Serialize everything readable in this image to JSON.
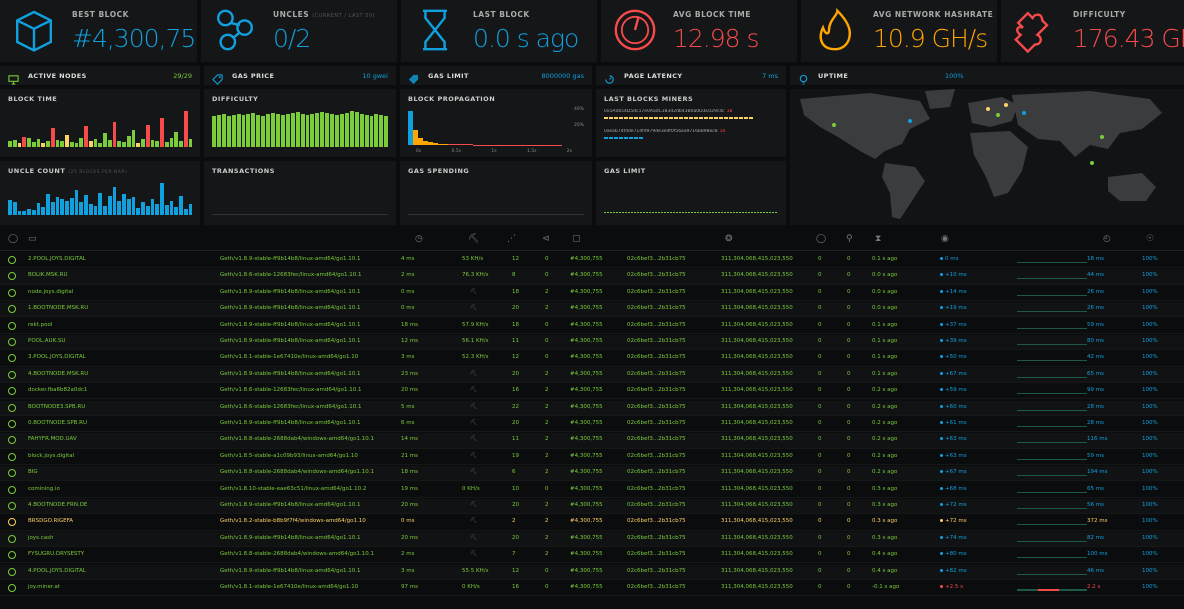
{
  "stats": [
    {
      "id": "best-block",
      "label": "BEST BLOCK",
      "sublabel": "",
      "value": "#4,300,755",
      "icon": "cube-icon",
      "color": "#10a0de"
    },
    {
      "id": "uncles",
      "label": "UNCLES",
      "sublabel": "(CURRENT / LAST 50)",
      "value": "0/2",
      "icon": "uncles-icon",
      "color": "#10a0de"
    },
    {
      "id": "last-block",
      "label": "LAST BLOCK",
      "sublabel": "",
      "value": "0.0 s ago",
      "icon": "hourglass-icon",
      "color": "#10a0de"
    },
    {
      "id": "avg-block-time",
      "label": "AVG BLOCK TIME",
      "sublabel": "",
      "value": "12.98 s",
      "icon": "gauge-icon",
      "color": "#f74b4b"
    },
    {
      "id": "avg-hashrate",
      "label": "AVG NETWORK HASHRATE",
      "sublabel": "",
      "value": "10.9 GH/s",
      "icon": "fire-icon",
      "color": "#ffa600"
    },
    {
      "id": "difficulty",
      "label": "DIFFICULTY",
      "sublabel": "",
      "value": "176.43 GH",
      "icon": "puzzle-icon",
      "color": "#f74b4b"
    }
  ],
  "info": [
    {
      "id": "active-nodes",
      "label": "ACTIVE NODES",
      "value": "29/29",
      "icon": "monitor-icon",
      "color": "#7bcc3a"
    },
    {
      "id": "gas-price",
      "label": "GAS PRICE",
      "value": "10 gwei",
      "icon": "gas-tag-icon",
      "color": "#10a0de"
    },
    {
      "id": "gas-limit",
      "label": "GAS LIMIT",
      "value": "8000000 gas",
      "icon": "gas-limit-icon",
      "color": "#10a0de"
    },
    {
      "id": "page-latency",
      "label": "PAGE LATENCY",
      "value": "7 ms",
      "icon": "latency-icon",
      "color": "#10a0de"
    },
    {
      "id": "uptime",
      "label": "UPTIME",
      "value": "100%",
      "icon": "lightbulb-icon",
      "color": "#10a0de"
    }
  ],
  "panels": {
    "block_time": "BLOCK TIME",
    "difficulty": "DIFFICULTY",
    "block_propagation": "BLOCK PROPAGATION",
    "last_blocks_miners": "LAST BLOCKS MINERS",
    "uncle_count": "UNCLE COUNT",
    "uncle_count_sub": "(25 BLOCKS PER BAR)",
    "transactions": "TRANSACTIONS",
    "gas_spending": "GAS SPENDING",
    "gas_limit": "GAS LIMIT"
  },
  "propagation": {
    "y_ticks": [
      "40%",
      "20%"
    ],
    "x_ticks": [
      "0s",
      "0.5s",
      "1s",
      "1.5s",
      "2s"
    ]
  },
  "miners": [
    {
      "address": "0x5A0b54D5dc17e0AadC383d2db43B0a0D3E029c4c",
      "count": "18"
    },
    {
      "address": "0xea674fdde714fd979de3edf0f56aa9716b898ec8",
      "count": "10"
    }
  ],
  "charts": {
    "block_time": [
      10,
      12,
      8,
      18,
      16,
      9,
      14,
      7,
      10,
      34,
      12,
      11,
      22,
      9,
      8,
      17,
      38,
      11,
      14,
      8,
      26,
      12,
      45,
      10,
      9,
      19,
      31,
      8,
      15,
      40,
      12,
      11,
      52,
      9,
      16,
      28,
      10,
      65,
      14
    ],
    "block_time_red": [
      3,
      9,
      16,
      22,
      29,
      32,
      37
    ],
    "difficulty": [
      62,
      64,
      66,
      63,
      65,
      67,
      64,
      66,
      68,
      65,
      63,
      66,
      69,
      67,
      64,
      66,
      68,
      70,
      66,
      65,
      67,
      69,
      71,
      68,
      66,
      64,
      67,
      69,
      72,
      70,
      67,
      65,
      63,
      66,
      64,
      62
    ],
    "propagation": [
      92,
      40,
      18,
      10,
      7,
      5,
      4,
      3,
      3,
      2,
      2,
      2,
      2,
      1,
      1,
      1,
      1,
      1,
      1,
      1,
      1,
      1,
      1,
      1,
      1,
      1,
      1,
      1,
      1,
      1,
      1
    ],
    "uncle_count": [
      42,
      38,
      12,
      10,
      18,
      14,
      34,
      22,
      60,
      36,
      52,
      44,
      40,
      48,
      70,
      38,
      56,
      30,
      26,
      62,
      24,
      54,
      80,
      40,
      58,
      46,
      50,
      20,
      36,
      24,
      44,
      32,
      90,
      28,
      40,
      22,
      54,
      18,
      30
    ]
  },
  "map_dots": [
    {
      "country": "US-West",
      "color": "#7bcc3a"
    },
    {
      "country": "US-East",
      "color": "#10a0de"
    },
    {
      "country": "Europe-West",
      "color": "#ffd162"
    },
    {
      "country": "Europe-Central",
      "color": "#7bcc3a"
    },
    {
      "country": "Russia",
      "color": "#10a0de"
    },
    {
      "country": "China",
      "color": "#7bcc3a"
    }
  ],
  "table": {
    "headers": [
      "check-icon",
      "monitor-icon",
      "",
      "clock-icon",
      "pickaxe-icon",
      "peers-icon",
      "pending-icon",
      "cube-icon",
      "",
      "",
      "",
      "fingerprint-icon",
      "",
      "check-icon",
      "uncles-icon",
      "hourglass-icon",
      "gauge-icon",
      "",
      "latency-icon",
      "lightbulb-icon"
    ],
    "rows": [
      {
        "name": "2.POOL.JOYS.DIGITAL",
        "client": "Geth/v1.8.9-stable-ff9b14b8/linux-amd64/go1.10.1",
        "lat": "4 ms",
        "hash": "53 KH/s",
        "peers": "12",
        "pending": "0",
        "block": "#4,300,755",
        "hash_short": "02c6bef3...2b31cb75",
        "diff": "311,304,068,415,023,550",
        "unc": "0",
        "unc2": "0",
        "last": "0.1 s ago",
        "prop": "0 ms",
        "lat2": "18 ms",
        "up": "100%"
      },
      {
        "name": "BOLIK.MSK.RU",
        "client": "Geth/v1.8.6-stable-12683fec/linux-amd64/go1.10.1",
        "lat": "2 ms",
        "hash": "76.3 KH/s",
        "peers": "8",
        "pending": "0",
        "block": "#4,300,755",
        "hash_short": "02c6bef3...2b31cb75",
        "diff": "311,304,068,415,023,550",
        "unc": "0",
        "unc2": "0",
        "last": "0.0 s ago",
        "prop": "+10 ms",
        "lat2": "44 ms",
        "up": "100%"
      },
      {
        "name": "node.joys.digital",
        "client": "Geth/v1.8.9-stable-ff9b14b8/linux-amd64/go1.10.1",
        "lat": "0 ms",
        "hash": "",
        "peers": "18",
        "pending": "2",
        "block": "#4,300,755",
        "hash_short": "02c6bef3...2b31cb75",
        "diff": "311,304,068,415,023,550",
        "unc": "0",
        "unc2": "0",
        "last": "0.0 s ago",
        "prop": "+14 ms",
        "lat2": "26 ms",
        "up": "100%"
      },
      {
        "name": "1.BOOTNODE.MSK.RU",
        "client": "Geth/v1.8.9-stable-ff9b14b8/linux-amd64/go1.10.1",
        "lat": "0 ms",
        "hash": "",
        "peers": "20",
        "pending": "2",
        "block": "#4,300,755",
        "hash_short": "02c6bef3...2b31cb75",
        "diff": "311,304,068,415,023,550",
        "unc": "0",
        "unc2": "0",
        "last": "0.0 s ago",
        "prop": "+19 ms",
        "lat2": "26 ms",
        "up": "100%"
      },
      {
        "name": "rekt.pool",
        "client": "Geth/v1.8.9-stable-ff9b14b8/linux-amd64/go1.10.1",
        "lat": "18 ms",
        "hash": "57.9 KH/s",
        "peers": "18",
        "pending": "0",
        "block": "#4,300,755",
        "hash_short": "02c6bef3...2b31cb75",
        "diff": "311,304,068,415,023,550",
        "unc": "0",
        "unc2": "0",
        "last": "0.1 s ago",
        "prop": "+37 ms",
        "lat2": "59 ms",
        "up": "100%"
      },
      {
        "name": "POOL.AUK.SU",
        "client": "Geth/v1.8.9-stable-ff9b14b8/linux-amd64/go1.10.1",
        "lat": "12 ms",
        "hash": "56.1 KH/s",
        "peers": "11",
        "pending": "0",
        "block": "#4,300,755",
        "hash_short": "02c6bef3...2b31cb75",
        "diff": "311,304,068,415,023,550",
        "unc": "0",
        "unc2": "0",
        "last": "0.1 s ago",
        "prop": "+39 ms",
        "lat2": "80 ms",
        "up": "100%"
      },
      {
        "name": "3.POOL.JOYS.DIGITAL",
        "client": "Geth/v1.8.1-stable-1e67410e/linux-amd64/go1.10",
        "lat": "3 ms",
        "hash": "52.3 KH/s",
        "peers": "12",
        "pending": "0",
        "block": "#4,300,755",
        "hash_short": "02c6bef3...2b31cb75",
        "diff": "311,304,068,415,023,550",
        "unc": "0",
        "unc2": "0",
        "last": "0.1 s ago",
        "prop": "+50 ms",
        "lat2": "42 ms",
        "up": "100%"
      },
      {
        "name": "4.BOOTNODE.MSK.RU",
        "client": "Geth/v1.8.9-stable-ff9b14b8/linux-amd64/go1.10.1",
        "lat": "23 ms",
        "hash": "",
        "peers": "20",
        "pending": "2",
        "block": "#4,300,755",
        "hash_short": "02c6bef3...2b31cb75",
        "diff": "311,304,068,415,023,550",
        "unc": "0",
        "unc2": "0",
        "last": "0.1 s ago",
        "prop": "+67 ms",
        "lat2": "65 ms",
        "up": "100%"
      },
      {
        "name": "docker.fba6b82a0dc1",
        "client": "Geth/v1.8.6-stable-12683fec/linux-amd64/go1.10.1",
        "lat": "20 ms",
        "hash": "",
        "peers": "16",
        "pending": "2",
        "block": "#4,300,755",
        "hash_short": "02c6bef3...2b31cb75",
        "diff": "311,304,068,415,023,550",
        "unc": "0",
        "unc2": "0",
        "last": "0.2 s ago",
        "prop": "+59 ms",
        "lat2": "99 ms",
        "up": "100%"
      },
      {
        "name": "BOOTNODE3.SPB.RU",
        "client": "Geth/v1.8.6-stable-12683fec/linux-amd64/go1.10.1",
        "lat": "5 ms",
        "hash": "",
        "peers": "22",
        "pending": "2",
        "block": "#4,300,755",
        "hash_short": "02c6bef3...2b31cb75",
        "diff": "311,304,068,415,023,550",
        "unc": "0",
        "unc2": "0",
        "last": "0.2 s ago",
        "prop": "+60 ms",
        "lat2": "28 ms",
        "up": "100%"
      },
      {
        "name": "0.BOOTNODE.SPB.RU",
        "client": "Geth/v1.8.9-stable-ff9b14b8/linux-amd64/go1.10.1",
        "lat": "6 ms",
        "hash": "",
        "peers": "20",
        "pending": "2",
        "block": "#4,300,755",
        "hash_short": "02c6bef3...2b31cb75",
        "diff": "311,304,068,415,023,550",
        "unc": "0",
        "unc2": "0",
        "last": "0.2 s ago",
        "prop": "+61 ms",
        "lat2": "28 ms",
        "up": "100%"
      },
      {
        "name": "FAHYFR.MOD.UAV",
        "client": "Geth/v1.8.8-stable-2688dab4/windows-amd64/go1.10.1",
        "lat": "14 ms",
        "hash": "",
        "peers": "11",
        "pending": "2",
        "block": "#4,300,755",
        "hash_short": "02c6bef3...2b31cb75",
        "diff": "311,304,068,415,023,550",
        "unc": "0",
        "unc2": "0",
        "last": "0.2 s ago",
        "prop": "+63 ms",
        "lat2": "116 ms",
        "up": "100%"
      },
      {
        "name": "block.joys.digital",
        "client": "Geth/v1.8.5-stable-a1c09b93/linux-amd64/go1.10",
        "lat": "21 ms",
        "hash": "",
        "peers": "19",
        "pending": "2",
        "block": "#4,300,755",
        "hash_short": "02c6bef3...2b31cb75",
        "diff": "311,304,068,415,023,550",
        "unc": "0",
        "unc2": "0",
        "last": "0.2 s ago",
        "prop": "+63 ms",
        "lat2": "59 ms",
        "up": "100%"
      },
      {
        "name": "BIG",
        "client": "Geth/v1.8.8-stable-2688dab4/windows-amd64/go1.10.1",
        "lat": "18 ms",
        "hash": "",
        "peers": "6",
        "pending": "2",
        "block": "#4,300,755",
        "hash_short": "02c6bef3...2b31cb75",
        "diff": "311,304,068,415,023,550",
        "unc": "0",
        "unc2": "0",
        "last": "0.2 s ago",
        "prop": "+67 ms",
        "lat2": "194 ms",
        "up": "100%"
      },
      {
        "name": "comining.io",
        "client": "Geth/v1.8.10-stable-eae63c51/linux-amd64/go1.10.2",
        "lat": "19 ms",
        "hash": "0 KH/s",
        "peers": "10",
        "pending": "0",
        "block": "#4,300,755",
        "hash_short": "02c6bef3...2b31cb75",
        "diff": "311,304,068,415,023,550",
        "unc": "0",
        "unc2": "0",
        "last": "0.3 s ago",
        "prop": "+68 ms",
        "lat2": "65 ms",
        "up": "100%"
      },
      {
        "name": "4.BOOTNODE.FRN.DE",
        "client": "Geth/v1.8.9-stable-ff9b14b8/linux-amd64/go1.10.1",
        "lat": "20 ms",
        "hash": "",
        "peers": "20",
        "pending": "2",
        "block": "#4,300,755",
        "hash_short": "02c6bef3...2b31cb75",
        "diff": "311,304,068,415,023,550",
        "unc": "0",
        "unc2": "0",
        "last": "0.3 s ago",
        "prop": "+72 ms",
        "lat2": "56 ms",
        "up": "100%"
      },
      {
        "name": "BRSDGO.RIGEFA",
        "client": "Geth/v1.8.2-stable-b8b9f7f4/windows-amd64/go1.10",
        "lat": "0 ms",
        "hash": "",
        "peers": "2",
        "pending": "2",
        "block": "#4,300,755",
        "hash_short": "02c6bef3...2b31cb75",
        "diff": "311,304,068,415,023,550",
        "unc": "0",
        "unc2": "0",
        "last": "0.3 s ago",
        "prop": "+72 ms",
        "lat2": "372 ms",
        "up": "100%",
        "warn": true
      },
      {
        "name": "joys.cash",
        "client": "Geth/v1.8.9-stable-ff9b14b8/linux-amd64/go1.10.1",
        "lat": "20 ms",
        "hash": "",
        "peers": "20",
        "pending": "2",
        "block": "#4,300,755",
        "hash_short": "02c6bef3...2b31cb75",
        "diff": "311,304,068,415,023,550",
        "unc": "0",
        "unc2": "0",
        "last": "0.3 s ago",
        "prop": "+74 ms",
        "lat2": "82 ms",
        "up": "100%"
      },
      {
        "name": "FYSUGRU.DRYSESTY",
        "client": "Geth/v1.8.8-stable-2688dab4/windows-amd64/go1.10.1",
        "lat": "2 ms",
        "hash": "",
        "peers": "7",
        "pending": "2",
        "block": "#4,300,755",
        "hash_short": "02c6bef3...2b31cb75",
        "diff": "311,304,068,415,023,550",
        "unc": "0",
        "unc2": "0",
        "last": "0.4 s ago",
        "prop": "+80 ms",
        "lat2": "100 ms",
        "up": "100%"
      },
      {
        "name": "4.POOL.JOYS.DIGITAL",
        "client": "Geth/v1.8.9-stable-ff9b14b8/linux-amd64/go1.10.1",
        "lat": "3 ms",
        "hash": "55.5 KH/s",
        "peers": "12",
        "pending": "0",
        "block": "#4,300,755",
        "hash_short": "02c6bef3...2b31cb75",
        "diff": "311,304,068,415,023,550",
        "unc": "0",
        "unc2": "0",
        "last": "0.4 s ago",
        "prop": "+82 ms",
        "lat2": "46 ms",
        "up": "100%"
      },
      {
        "name": "joy.miner.at",
        "client": "Geth/v1.8.1-stable-1e67410e/linux-amd64/go1.10",
        "lat": "97 ms",
        "hash": "0 KH/s",
        "peers": "16",
        "pending": "0",
        "block": "#4,300,755",
        "hash_short": "02c6bef3...2b31cb75",
        "diff": "311,304,068,415,023,550",
        "unc": "0",
        "unc2": "0",
        "last": "-0.1 s ago",
        "prop": "+2.5 s",
        "lat2": "2.2 s",
        "up": "100%",
        "bad": true
      }
    ]
  }
}
